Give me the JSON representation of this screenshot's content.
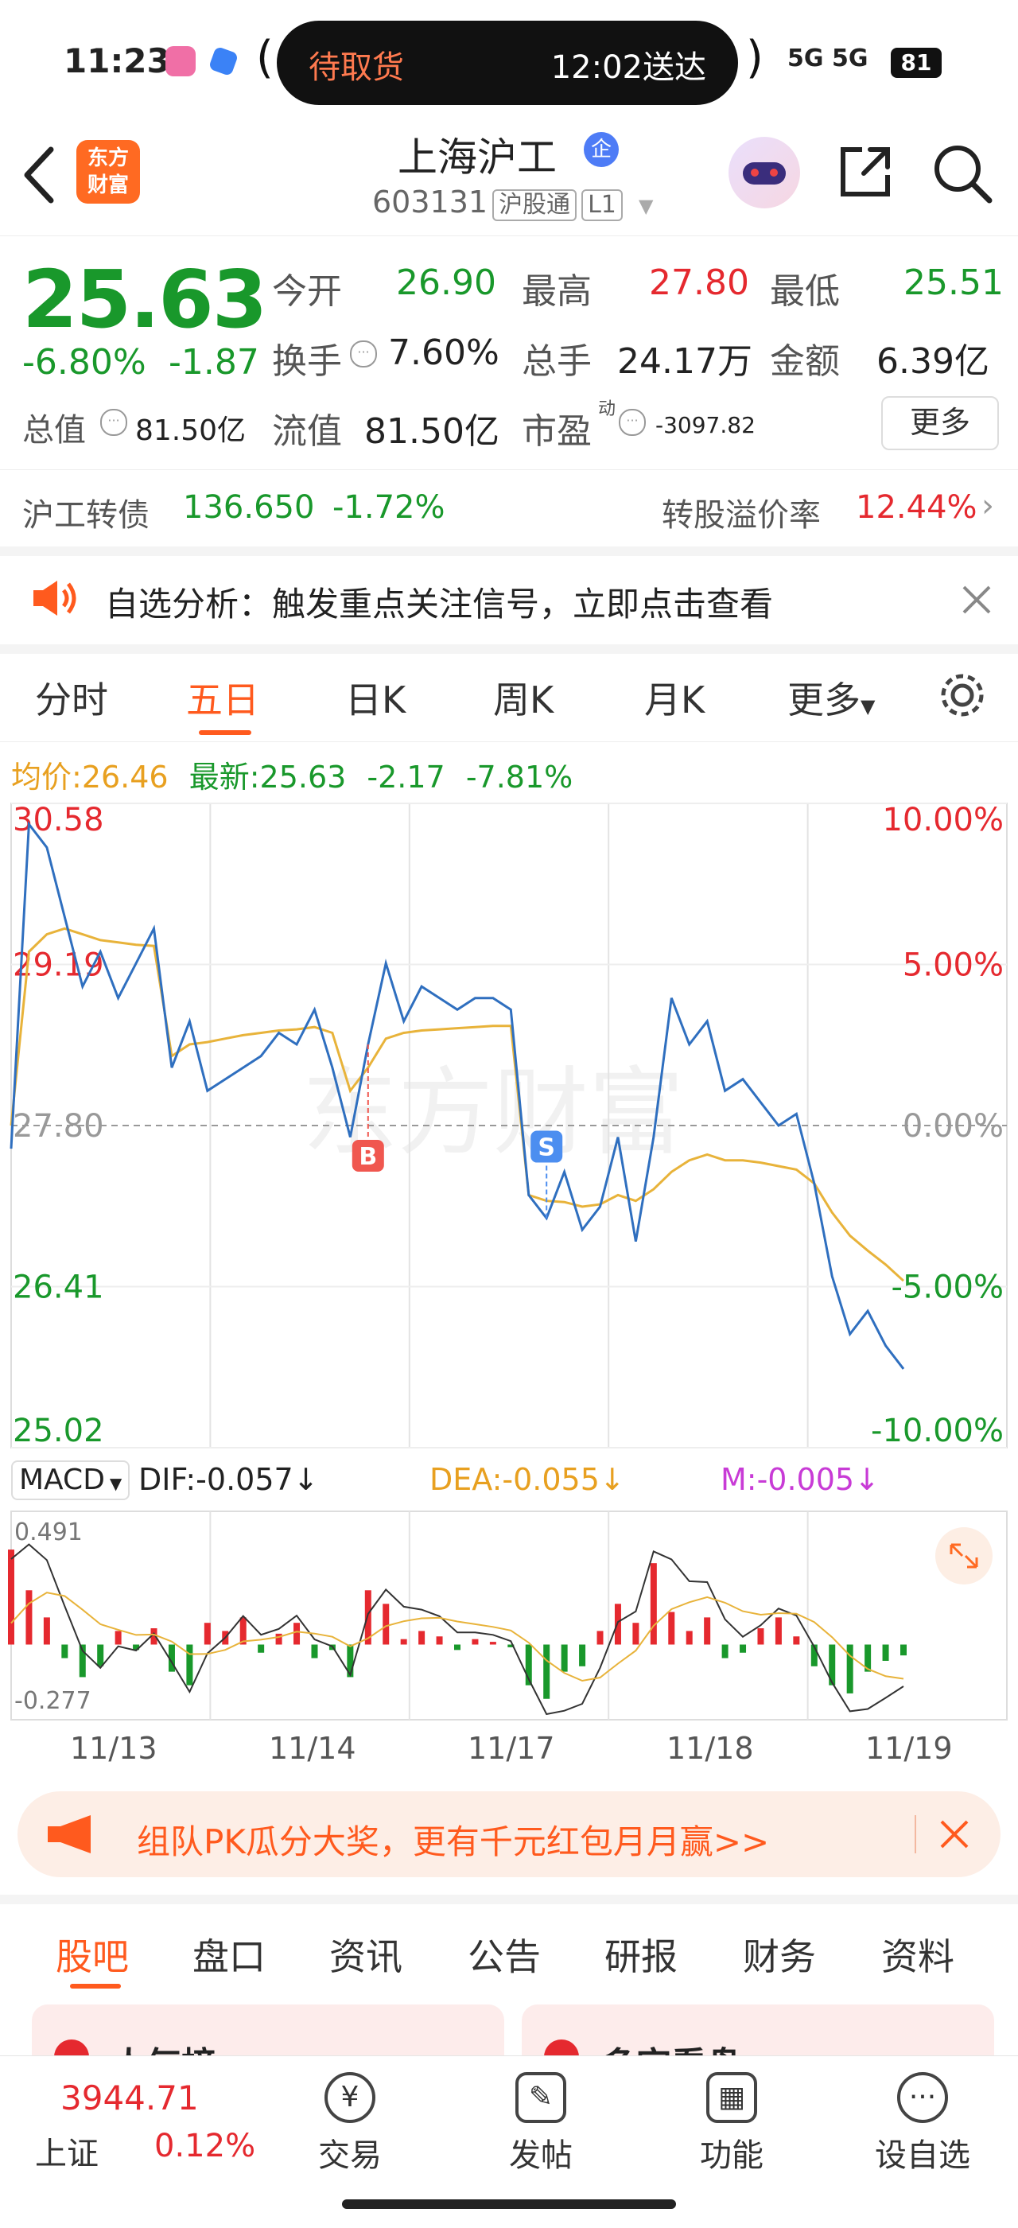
{
  "status_bar": {
    "time": "11:23",
    "pill_left": "待取货",
    "pill_right": "12:02送达",
    "network": "5G 5G",
    "battery": "81"
  },
  "header": {
    "logo_line1": "东方",
    "logo_line2": "财富",
    "title": "上海沪工",
    "enterprise_badge": "企",
    "code": "603131",
    "tag_connect": "沪股通",
    "tag_level": "L1"
  },
  "quote": {
    "price": "25.63",
    "change_pct": "-6.80%",
    "change_amt": "-1.87",
    "open_label": "今开",
    "open": "26.90",
    "high_label": "最高",
    "high": "27.80",
    "low_label": "最低",
    "low": "25.51",
    "turnover_label": "换手",
    "turnover": "7.60%",
    "volume_label": "总手",
    "volume": "24.17万",
    "amount_label": "金额",
    "amount": "6.39亿",
    "mktcap_label": "总值",
    "mktcap": "81.50亿",
    "float_label": "流值",
    "float": "81.50亿",
    "pe_label": "市盈",
    "pe_sup": "动",
    "pe": "-3097.82",
    "more_button": "更多"
  },
  "bond": {
    "name": "沪工转债",
    "price": "136.650",
    "change": "-1.72%",
    "premium_label": "转股溢价率",
    "premium": "12.44%"
  },
  "notice": {
    "text": "自选分析：触发重点关注信号，立即点击查看"
  },
  "chart_tabs": [
    "分时",
    "五日",
    "日K",
    "周K",
    "月K",
    "更多"
  ],
  "chart_header": {
    "avg_label": "均价:",
    "avg": "26.46",
    "latest_label": "最新:",
    "latest": "25.63",
    "chg": "-2.17",
    "chg_pct": "-7.81%"
  },
  "chart_data": {
    "type": "line",
    "y_left_ticks": [
      "30.58",
      "29.19",
      "27.80",
      "26.41",
      "25.02"
    ],
    "y_right_ticks": [
      "10.00%",
      "5.00%",
      "0.00%",
      "-5.00%",
      "-10.00%"
    ],
    "ylim": [
      25.02,
      30.58
    ],
    "prev_close": 27.8,
    "x_labels": [
      "11/13",
      "11/14",
      "11/17",
      "11/18",
      "11/19"
    ],
    "watermark": "东方财富",
    "trade_marks": [
      {
        "label": "B",
        "day": 3
      },
      {
        "label": "S",
        "day": 4
      }
    ],
    "series": [
      {
        "name": "最新",
        "color": "#2f6fbf",
        "values": [
          27.6,
          30.4,
          30.2,
          29.6,
          29.0,
          29.3,
          28.9,
          29.2,
          29.5,
          28.3,
          28.7,
          28.1,
          28.2,
          28.3,
          28.4,
          28.6,
          28.5,
          28.8,
          28.3,
          27.7,
          28.5,
          29.2,
          28.7,
          29.0,
          28.9,
          28.8,
          28.9,
          28.9,
          28.8,
          27.2,
          27.0,
          27.4,
          26.9,
          27.1,
          27.7,
          26.8,
          27.7,
          28.9,
          28.5,
          28.7,
          28.1,
          28.2,
          28.0,
          27.8,
          27.9,
          27.3,
          26.5,
          26.0,
          26.2,
          25.9,
          25.7
        ]
      },
      {
        "name": "均价",
        "color": "#e8b33a",
        "values": [
          27.8,
          29.3,
          29.45,
          29.5,
          29.45,
          29.4,
          29.38,
          29.36,
          29.35,
          28.4,
          28.5,
          28.52,
          28.55,
          28.58,
          28.6,
          28.62,
          28.63,
          28.65,
          28.6,
          28.1,
          28.3,
          28.55,
          28.6,
          28.62,
          28.63,
          28.64,
          28.65,
          28.66,
          28.66,
          27.2,
          27.15,
          27.14,
          27.1,
          27.12,
          27.2,
          27.15,
          27.25,
          27.4,
          27.5,
          27.55,
          27.5,
          27.5,
          27.48,
          27.45,
          27.42,
          27.3,
          27.05,
          26.85,
          26.72,
          26.6,
          26.46
        ]
      }
    ]
  },
  "macd": {
    "selector": "MACD",
    "dif": "DIF:-0.057↓",
    "dea": "DEA:-0.055↓",
    "m": "M:-0.005↓",
    "ymax_label": "0.491",
    "ymin_label": "-0.277",
    "histogram": [
      0.35,
      0.2,
      0.1,
      -0.05,
      -0.12,
      -0.08,
      0.05,
      -0.02,
      0.06,
      -0.1,
      -0.15,
      0.08,
      0.05,
      0.1,
      -0.03,
      0.04,
      0.08,
      -0.05,
      -0.02,
      -0.12,
      0.2,
      0.15,
      0.02,
      0.05,
      0.03,
      -0.02,
      0.02,
      0.01,
      -0.01,
      -0.15,
      -0.2,
      -0.1,
      -0.08,
      0.05,
      0.15,
      0.08,
      0.3,
      0.12,
      0.05,
      0.1,
      -0.05,
      -0.03,
      0.06,
      0.1,
      0.03,
      -0.08,
      -0.15,
      -0.18,
      -0.1,
      -0.06,
      -0.04
    ]
  },
  "promo": {
    "text": "组队PK瓜分大奖，更有千元红包月月赢>>"
  },
  "bottom_tabs": [
    "股吧",
    "盘口",
    "资讯",
    "公告",
    "研报",
    "财务",
    "资料"
  ],
  "cards": {
    "left": "人气榜",
    "right": "多空看盘"
  },
  "bottom_nav": {
    "index_value": "3944.71",
    "index_name": "上证",
    "index_change": "0.12%",
    "items": [
      "交易",
      "发帖",
      "功能",
      "设自选"
    ]
  }
}
